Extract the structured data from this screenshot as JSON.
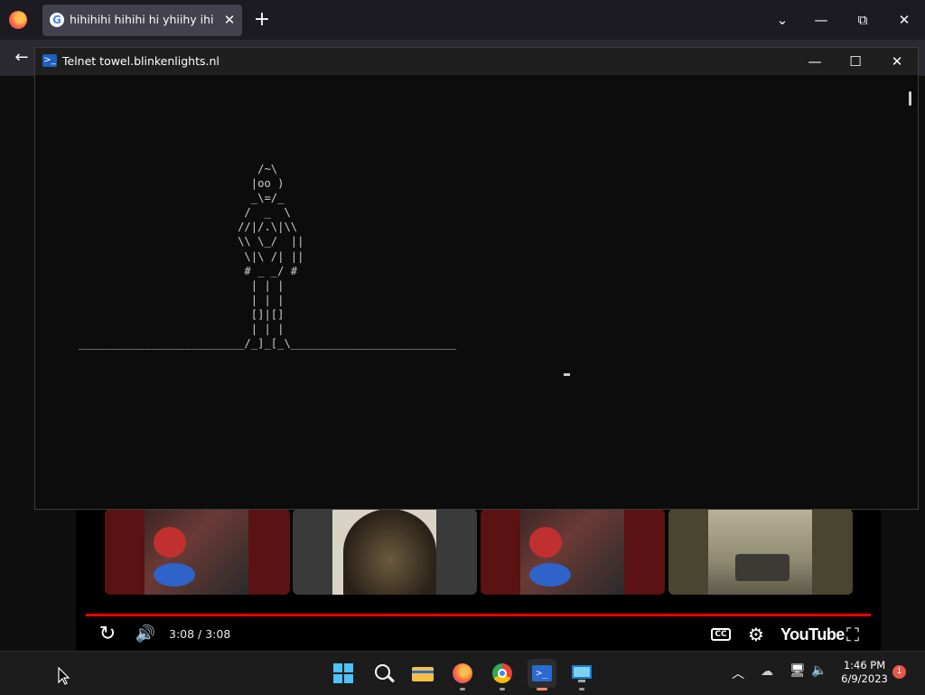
{
  "browser": {
    "tab_title": "hihihihi hihihi hi yhiihy ihih ii hi",
    "tab_favicon": "G",
    "new_tab_label": "+",
    "back_label": "←",
    "list_tabs_label": "⌄",
    "minimize_label": "—",
    "restore_label": "⧉",
    "close_label": "✕"
  },
  "telnet": {
    "title": "Telnet towel.blinkenlights.nl",
    "icon": "powershell-icon",
    "minimize_label": "—",
    "maximize_label": "☐",
    "close_label": "✕",
    "ascii_art": "                           /~\\\n                          |oo )\n                          _\\=/_\n                         /  _  \\\n                        //|/.\\|\\\\\n                        \\\\ \\_/  ||\n                         \\|\\ /| ||\n                         # _ _/ #\n                          | | |\n                          | | |\n                          []|[]\n                          | | |\n_________________________/_]_[_\\_________________________"
  },
  "player": {
    "time": "3:08 / 3:08",
    "replay_label": "↻",
    "volume_label": "🔊",
    "cc_label": "CC",
    "settings_label": "⚙",
    "logo_text": "YouTube",
    "fullscreen_label": "⛶",
    "progress_fraction": 1.0
  },
  "taskbar": {
    "time": "1:46 PM",
    "date": "6/9/2023",
    "notification_count": "1",
    "icons": [
      "windows-start-icon",
      "search-icon",
      "file-explorer-icon",
      "firefox-icon",
      "chrome-icon",
      "powershell-icon",
      "remote-desktop-icon"
    ]
  }
}
